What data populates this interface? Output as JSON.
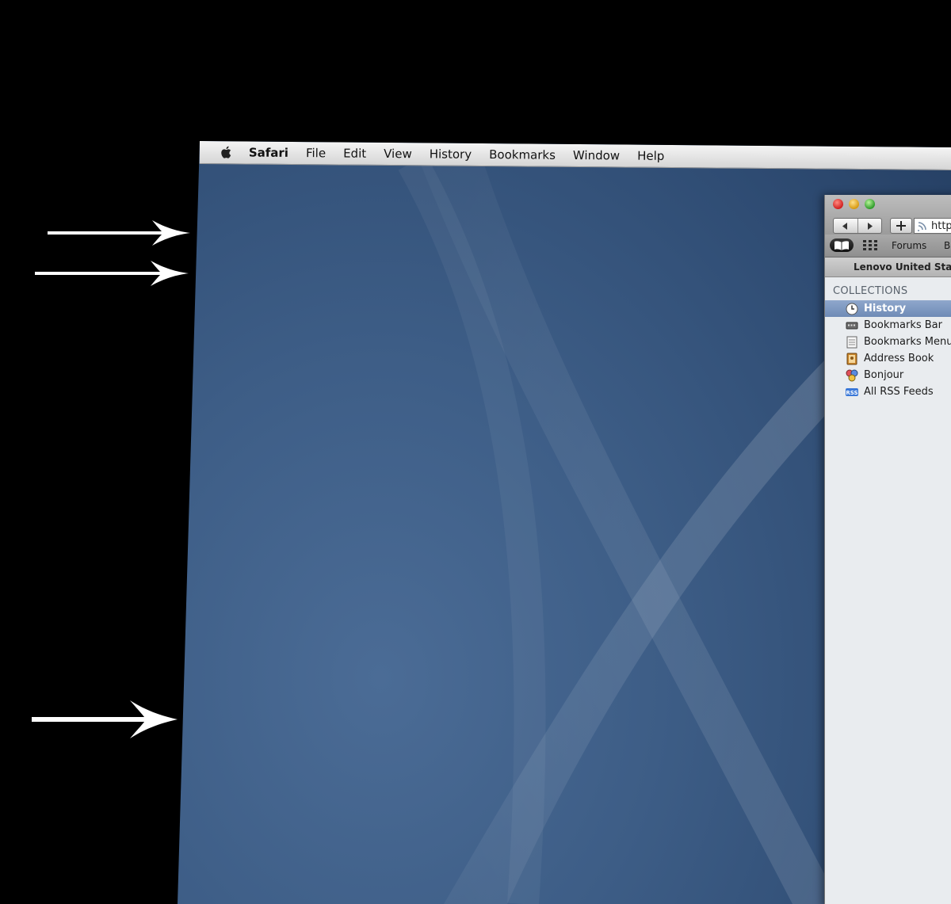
{
  "menubar": {
    "app_name": "Safari",
    "items": [
      "File",
      "Edit",
      "View",
      "History",
      "Bookmarks",
      "Window",
      "Help"
    ]
  },
  "window": {
    "url_text": "http",
    "bookmarks_bar": {
      "link1": "Forums",
      "link2": "B"
    },
    "tab_title": "Lenovo United Stat",
    "sidebar": {
      "heading": "COLLECTIONS",
      "items": [
        {
          "label": "History",
          "icon": "clock-icon",
          "selected": true
        },
        {
          "label": "Bookmarks Bar",
          "icon": "bookmarks-bar-icon",
          "selected": false
        },
        {
          "label": "Bookmarks Menu",
          "icon": "bookmarks-menu-icon",
          "selected": false
        },
        {
          "label": "Address Book",
          "icon": "address-book-icon",
          "selected": false
        },
        {
          "label": "Bonjour",
          "icon": "bonjour-icon",
          "selected": false
        },
        {
          "label": "All RSS Feeds",
          "icon": "rss-icon",
          "selected": false
        }
      ]
    }
  },
  "colors": {
    "desktop_blue": "#3d5d86",
    "selection": "#7891bb",
    "annotation_arrow": "#ffffff"
  }
}
